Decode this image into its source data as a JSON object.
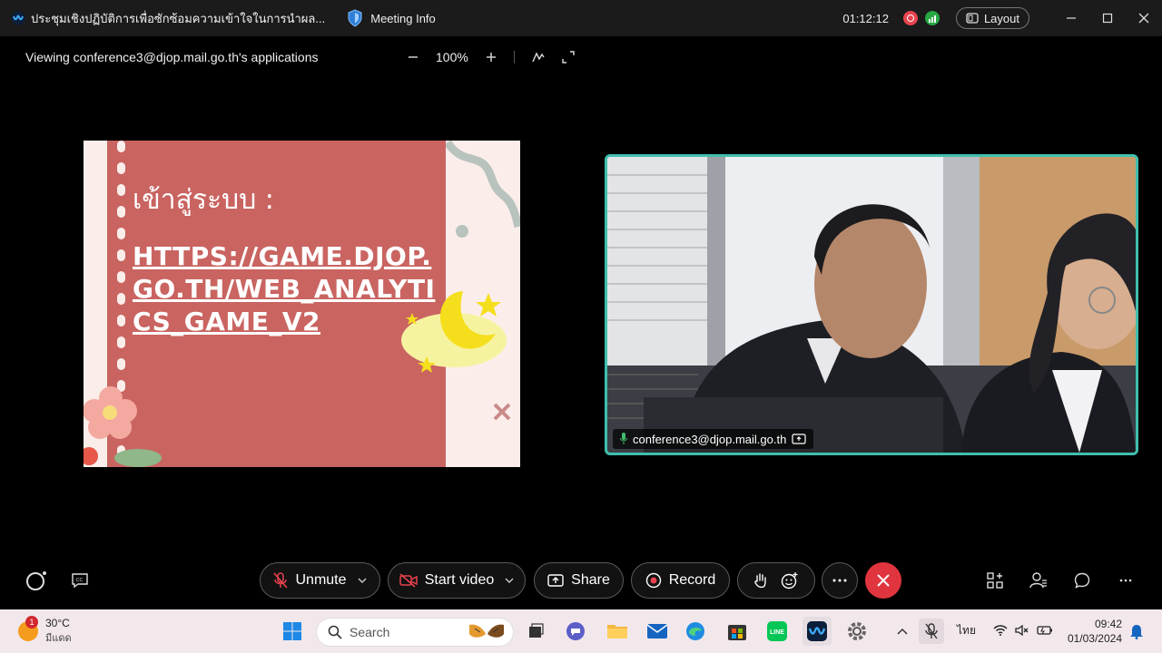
{
  "titlebar": {
    "title": "ประชุมเชิงปฏิบัติการเพื่อซักซ้อมความเข้าใจในการนำผล...",
    "meeting_info": "Meeting Info",
    "elapsed": "01:12:12",
    "layout_label": "Layout"
  },
  "viewbar": {
    "viewing_label": "Viewing conference3@djop.mail.go.th's applications",
    "zoom_value": "100%"
  },
  "slide": {
    "heading": "เข้าสู่ระบบ :",
    "url": "HTTPS://GAME.DJOP.GO.TH/WEB_ANALYTICS_GAME_V2"
  },
  "video": {
    "participant_name": "conference3@djop.mail.go.th"
  },
  "controls": {
    "unmute": "Unmute",
    "start_video": "Start video",
    "share": "Share",
    "record": "Record"
  },
  "taskbar": {
    "temperature": "30°C",
    "weather_desc": "มีแดด",
    "weather_badge": "1",
    "search_placeholder": "Search",
    "language": "ไทย",
    "time": "09:42",
    "date": "01/03/2024"
  },
  "colors": {
    "accent_teal": "#3fbfae",
    "end_call_red": "#e0353f",
    "slide_red": "#c96461"
  }
}
